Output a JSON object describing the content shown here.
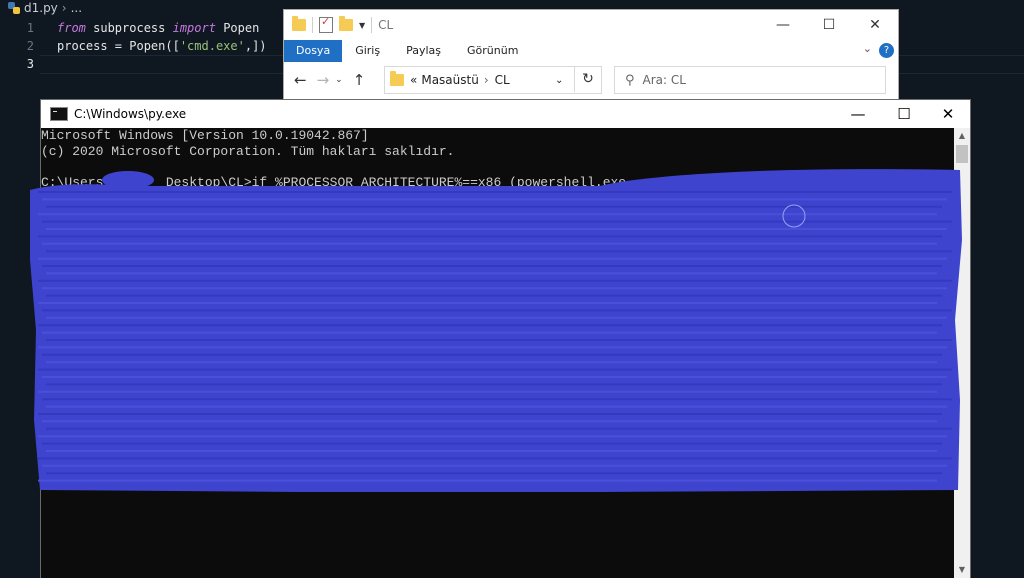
{
  "editor": {
    "breadcrumb": {
      "file": "d1.py",
      "rest": "..."
    },
    "line_numbers": [
      "1",
      "2",
      "3"
    ],
    "code": {
      "line1": {
        "kw1": "from",
        "t1": " subprocess ",
        "kw2": "import",
        "t2": " Popen"
      },
      "line2": {
        "t1": "process = Popen([",
        "str": "'cmd.exe'",
        "t2": ",])"
      }
    }
  },
  "explorer": {
    "title": "CL",
    "tabs": [
      "Dosya",
      "Giriş",
      "Paylaş",
      "Görünüm"
    ],
    "address": {
      "prefix": "«",
      "crumb1": "Masaüstü",
      "sep": "›",
      "crumb2": "CL"
    },
    "search_placeholder": "Ara: CL",
    "help": "?"
  },
  "console": {
    "title": "C:\\Windows\\py.exe",
    "lines": [
      "Microsoft Windows [Version 10.0.19042.867]",
      "(c) 2020 Microsoft Corporation. Tüm hakları saklıdır.",
      "",
      "C:\\Users        Desktop\\CL>if %PROCESSOR_ARCHITECTURE%==x86 (powershell.exe -"
    ]
  },
  "colors": {
    "redaction": "#3f44cf",
    "ribbon_active": "#1f6fc5",
    "console_bg": "#0c0c0c",
    "console_text": "#cccccc"
  },
  "icons": [
    "python-file-icon",
    "folder-icon",
    "properties-icon",
    "back-arrow-icon",
    "forward-arrow-icon",
    "up-arrow-icon",
    "refresh-icon",
    "search-icon",
    "minimize-icon",
    "maximize-icon",
    "close-icon",
    "help-icon",
    "console-icon"
  ]
}
